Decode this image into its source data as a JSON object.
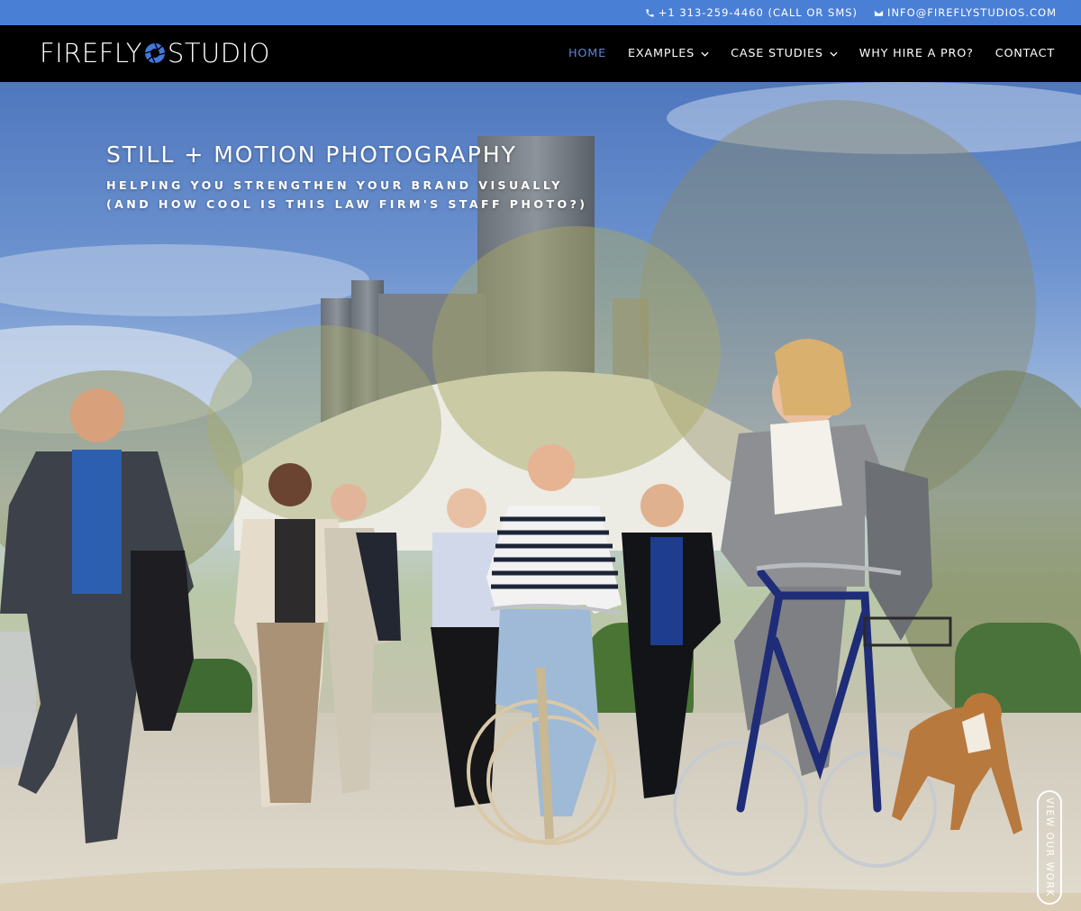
{
  "topbar": {
    "phone": "+1 313-259-4460 (CALL OR SMS)",
    "email": "INFO@FIREFLYSTUDIOS.COM"
  },
  "logo": {
    "part1": "FIREFLY",
    "part2": "STUDIO",
    "mark_icon": "aperture-icon"
  },
  "nav": {
    "items": [
      {
        "label": "HOME",
        "active": true,
        "dropdown": false
      },
      {
        "label": "EXAMPLES",
        "active": false,
        "dropdown": true
      },
      {
        "label": "CASE STUDIES",
        "active": false,
        "dropdown": true
      },
      {
        "label": "WHY HIRE A PRO?",
        "active": false,
        "dropdown": false
      },
      {
        "label": "CONTACT",
        "active": false,
        "dropdown": false
      }
    ]
  },
  "hero": {
    "title": "STILL + MOTION PHOTOGRAPHY",
    "subtitle_line1": "HELPING YOU STRENGTHEN YOUR BRAND VISUALLY",
    "subtitle_line2": "(AND HOW COOL IS THIS LAW FIRM'S STAFF PHOTO?)",
    "cta": "VIEW OUR WORK"
  },
  "colors": {
    "topbar": "#4a7fd6",
    "header": "#000000",
    "active_nav": "#5b86d8",
    "text": "#ffffff"
  }
}
